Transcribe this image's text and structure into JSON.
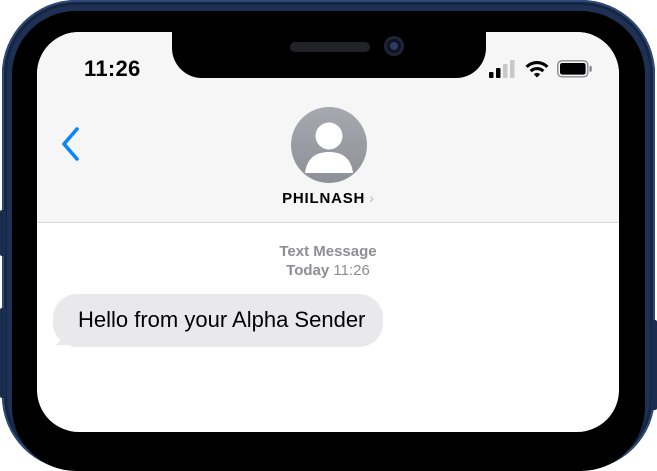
{
  "status_bar": {
    "time": "11:26",
    "icons": [
      "signal-icon",
      "wifi-icon",
      "battery-icon"
    ]
  },
  "nav": {
    "back_icon": "chevron-left-icon",
    "contact_name": "PHILNASH",
    "contact_chevron": "›",
    "avatar_icon": "person-icon"
  },
  "conversation": {
    "service_label": "Text Message",
    "day_label": "Today",
    "time_label": "11:26",
    "messages": [
      {
        "direction": "incoming",
        "text": "Hello from your Alpha Sender"
      }
    ]
  },
  "colors": {
    "accent": "#0a84ff",
    "bubble_incoming": "#e9e9eb",
    "meta_text": "#8e8e93",
    "frame": "#1e3155"
  }
}
